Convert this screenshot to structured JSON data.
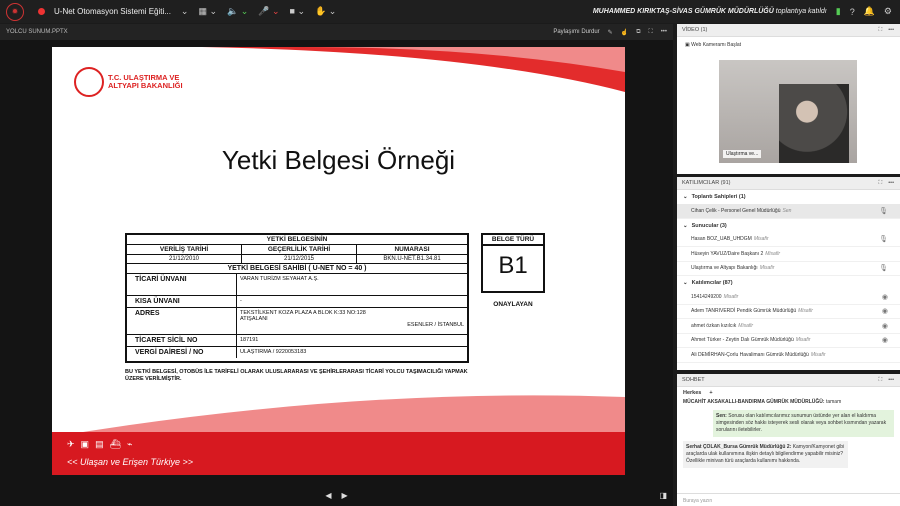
{
  "topbar": {
    "title": "U-Net Otomasyon Sistemi Eğiti...",
    "user_name": "MUHAMMED KIRIKTAŞ-SİVAS GÜMRÜK MÜDÜRLÜĞÜ",
    "user_status": "toplantıya katıldı",
    "icons": [
      "chevron-down-icon",
      "grid-icon",
      "speaker-icon",
      "mic-off-icon",
      "camera-icon",
      "hand-icon",
      "signal-icon",
      "help-icon",
      "bell-icon",
      "settings-icon"
    ]
  },
  "presentation": {
    "panel_title": "YOLCU SUNUM.PPTX",
    "stop_label": "Paylaşımı Durdur",
    "slide": {
      "logo_line1": "T.C. ULAŞTIRMA VE",
      "logo_line2": "ALTYAPI BAKANLIĞI",
      "title": "Yetki Belgesi Örneği",
      "cert_header": "YETKİ BELGESİNİN",
      "col_veriliş": "VERİLİŞ TARİHİ",
      "col_gecerlilik": "GEÇERLİLİK TARİHİ",
      "col_numara": "NUMARASI",
      "val_veriliş": "21/12/2010",
      "val_gecerlilik": "21/12/2015",
      "val_numara": "BKN.U-NET.B1.34.81",
      "sahibi_header": "YETKİ BELGESİ SAHİBİ ( U-NET NO = 40 )",
      "lbl_ticari": "TİCARİ ÜNVANI",
      "val_ticari": "VARAN TURİZM SEYAHAT A.Ş.",
      "lbl_kisa": "KISA ÜNVANI",
      "val_kisa": "-",
      "lbl_adres": "ADRES",
      "val_adres1": "TEKSTİLKENT KOZA PLAZA A BLOK K:33 NO:128",
      "val_adres2": "ATIŞALANI",
      "val_adres3": "ESENLER / İSTANBUL",
      "lbl_sicil": "TİCARET SİCİL NO",
      "val_sicil": "187191",
      "lbl_vergi": "VERGİ DAİRESİ / NO",
      "val_vergi": "ULAŞTIRMA / 9220053183",
      "belge_turu_label": "BELGE TÜRÜ",
      "belge_turu_value": "B1",
      "onay": "ONAYLAYAN",
      "note": "BU YETKİ BELGESİ, OTOBÜS İLE TARİFELİ OLARAK ULUSLARARASI VE ŞEHİRLERARASI TİCARİ YOLCU TAŞIMACILIĞI YAPMAK ÜZERE VERİLMİŞTİR.",
      "slogan": "<< Ulaşan ve Erişen Türkiye >>"
    }
  },
  "video": {
    "title": "VİDEO (1)",
    "cam_button": "Web Kameramı Başlat",
    "video_label": "Ulaştırma ve..."
  },
  "participants": {
    "title": "KATILIMCILAR (91)",
    "hosts_label": "Toplantı Sahipleri (1)",
    "hosts": [
      {
        "name": "Cihan Çelik - Personel Genel Müdürlüğü",
        "tag": "Sen"
      }
    ],
    "presenters_label": "Sunucular (3)",
    "presenters": [
      {
        "name": "Hasan BOZ_UAB_UHDGM",
        "tag": "Misafir"
      },
      {
        "name": "Hüseyin YAVUZ/Daire Başkanı 2",
        "tag": "Misafir"
      },
      {
        "name": "Ulaştırma ve Altyapı Bakanlığı",
        "tag": "Misafir"
      }
    ],
    "attendees_label": "Katılımcılar (87)",
    "attendees": [
      {
        "name": "15414249200",
        "tag": "Misafir"
      },
      {
        "name": "Adem TANRIVERDİ Pendik Gümrük Müdürlüğü",
        "tag": "Misafir"
      },
      {
        "name": "ahmet özkan kızılcık",
        "tag": "Misafir"
      },
      {
        "name": "Ahmet Türker - Zeytin Dalı Gümrük Müdürlüğü",
        "tag": "Misafir"
      },
      {
        "name": "Ali DEMİRHAN-Çorlu Havalimanı Gümrük Müdürlüğü",
        "tag": "Misafir"
      }
    ]
  },
  "chat": {
    "title": "SOHBET",
    "tab": "Herkes",
    "messages": [
      {
        "sender": "MÜCAHİT AKSAKALLI-BANDIRMA GÜMRÜK MÜDÜRLÜĞÜ:",
        "text": "tamam"
      },
      {
        "sender": "Sen:",
        "text": "Sorusu olan katılımcılarımız sunumun üstünde yer alan el kaldırma simgesinden söz hakkı isteyerek sesli olarak veya sohbet kısmından yazarak sorularını iletebilirler."
      },
      {
        "sender": "Serhat ÇOLAK_Bursa Gümrük Müdürlüğü 2:",
        "text": "Kamyon/Kamyonet gibi araçlarda ulak kullanımına ilişkin detaylı bilgilendirme yapabilir misiniz? Özellikle minivan türü araçlarda kullanımı hakkında."
      }
    ],
    "input_placeholder": "Buraya yazın"
  }
}
